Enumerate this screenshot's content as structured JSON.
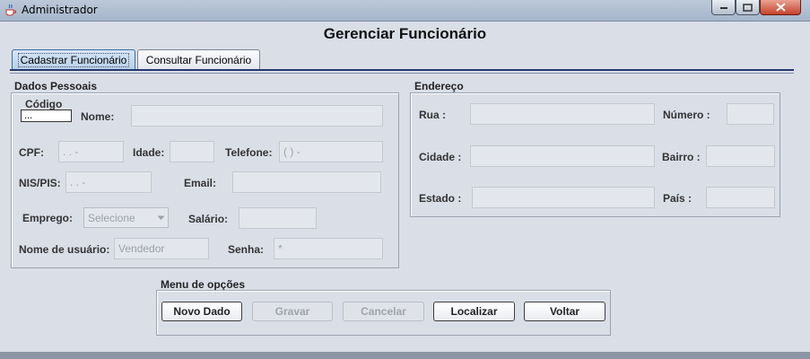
{
  "window": {
    "title": "Administrador"
  },
  "page": {
    "heading": "Gerenciar Funcionário"
  },
  "tabs": [
    {
      "label": "Cadastrar Funcionário",
      "selected": true
    },
    {
      "label": "Consultar Funcionário",
      "selected": false
    }
  ],
  "personal": {
    "title": "Dados Pessoais",
    "code_label": "Código",
    "code_value": "...",
    "name_label": "Nome:",
    "name_value": "",
    "cpf_label": "CPF:",
    "cpf_value": " .  .  -",
    "age_label": "Idade:",
    "age_value": "",
    "phone_label": "Telefone:",
    "phone_value": "(  )    -",
    "nis_label": "NIS/PIS:",
    "nis_value": "  .    .  -",
    "email_label": "Email:",
    "email_value": "",
    "job_label": "Emprego:",
    "job_value": "Selecione",
    "salary_label": "Salário:",
    "salary_value": "",
    "username_label": "Nome de usuário:",
    "username_placeholder": "Vendedor",
    "password_label": "Senha:",
    "password_placeholder": "*"
  },
  "address": {
    "title": "Endereço",
    "street_label": "Rua :",
    "street_value": "",
    "number_label": "Número :",
    "number_value": "",
    "city_label": "Cidade :",
    "city_value": "",
    "district_label": "Bairro :",
    "district_value": "",
    "state_label": "Estado :",
    "state_value": "",
    "country_label": "País :",
    "country_value": ""
  },
  "options": {
    "title": "Menu de opções",
    "new_label": "Novo Dado",
    "save_label": "Gravar",
    "cancel_label": "Cancelar",
    "find_label": "Localizar",
    "back_label": "Voltar"
  },
  "colors": {
    "window_bg": "#dadee7",
    "tab_line": "#25386b",
    "active_tab": "#b8cfe8",
    "close_button": "#c8412a"
  }
}
